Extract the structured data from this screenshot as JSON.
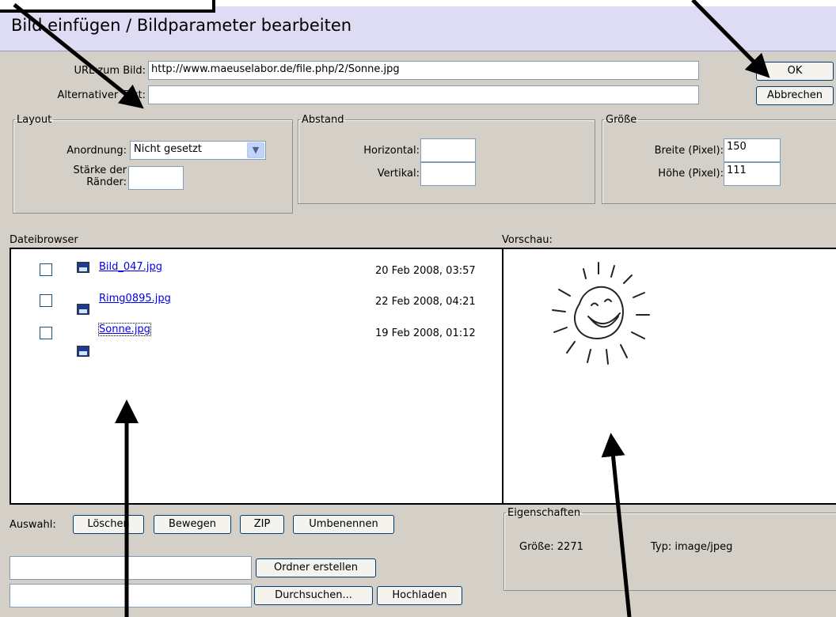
{
  "dialog": {
    "title": "Bild einfügen / Bildparameter bearbeiten",
    "url_label": "URL zum Bild:",
    "url_value": "http://www.maeuselabor.de/file.php/2/Sonne.jpg",
    "alt_label": "Alternativer Text:",
    "alt_value": "",
    "ok_label": "OK",
    "cancel_label": "Abbrechen"
  },
  "layout": {
    "legend": "Layout",
    "anordnung_label": "Anordnung:",
    "anordnung_value": "Nicht gesetzt",
    "staerke_label_1": "Stärke der",
    "staerke_label_2": "Ränder:",
    "staerke_value": ""
  },
  "abstand": {
    "legend": "Abstand",
    "horizontal_label": "Horizontal:",
    "horizontal_value": "",
    "vertikal_label": "Vertikal:",
    "vertikal_value": ""
  },
  "groesse": {
    "legend": "Größe",
    "breite_label": "Breite (Pixel):",
    "breite_value": "150",
    "hoehe_label": "Höhe (Pixel):",
    "hoehe_value": "111"
  },
  "browser": {
    "label": "Dateibrowser",
    "files": [
      {
        "name": "Bild_047.jpg",
        "date": "20 Feb 2008, 03:57"
      },
      {
        "name": "Rimg0895.jpg",
        "date": "22 Feb 2008, 04:21"
      },
      {
        "name": "Sonne.jpg",
        "date": "19 Feb 2008, 01:12"
      }
    ]
  },
  "preview": {
    "label": "Vorschau:"
  },
  "selection": {
    "label": "Auswahl:",
    "delete_label": "Löschen",
    "move_label": "Bewegen",
    "zip_label": "ZIP",
    "rename_label": "Umbenennen"
  },
  "actions": {
    "folder_value": "",
    "create_folder_label": "Ordner erstellen",
    "upload_value": "",
    "browse_label": "Durchsuchen...",
    "upload_label": "Hochladen"
  },
  "properties": {
    "legend": "Eigenschaften",
    "size_text": "Größe: 2271",
    "type_text": "Typ: image/jpeg"
  },
  "colors": {
    "dialog_bg": "#d4d0c8",
    "title_strip": "#dedbf5",
    "link": "#0000ee"
  }
}
